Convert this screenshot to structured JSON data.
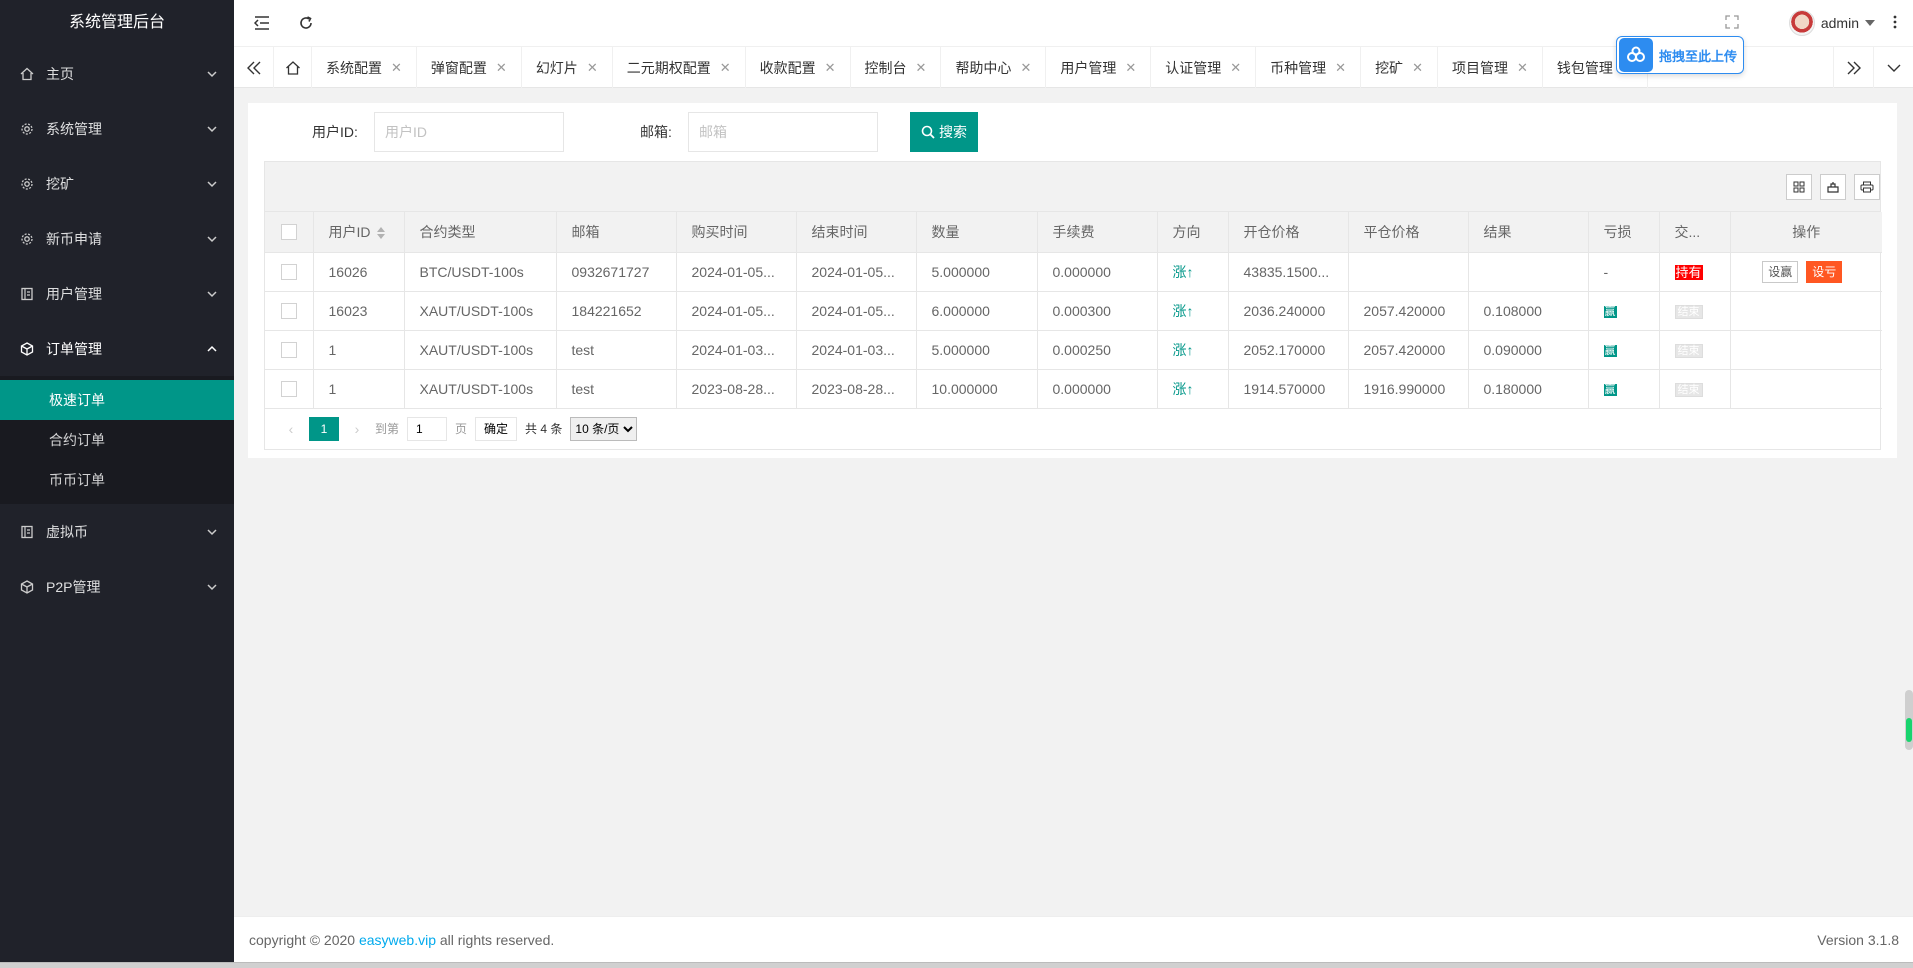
{
  "app": {
    "title": "系统管理后台"
  },
  "sidebar": {
    "items": [
      {
        "label": "主页",
        "icon": "home-icon"
      },
      {
        "label": "系统管理",
        "icon": "gear-icon"
      },
      {
        "label": "挖矿",
        "icon": "gear-icon"
      },
      {
        "label": "新币申请",
        "icon": "gear-icon"
      },
      {
        "label": "用户管理",
        "icon": "ledger-icon"
      },
      {
        "label": "订单管理",
        "icon": "cube-icon"
      },
      {
        "label": "虚拟币",
        "icon": "ledger-icon"
      },
      {
        "label": "P2P管理",
        "icon": "cube-icon"
      }
    ],
    "order_sub": [
      "极速订单",
      "合约订单",
      "币币订单"
    ]
  },
  "header": {
    "user": "admin"
  },
  "tabs": [
    "系统配置",
    "弹窗配置",
    "幻灯片",
    "二元期权配置",
    "收款配置",
    "控制台",
    "帮助中心",
    "用户管理",
    "认证管理",
    "币种管理",
    "挖矿",
    "项目管理",
    "钱包管理"
  ],
  "upload": {
    "label": "拖拽至此上传"
  },
  "search": {
    "uid_label": "用户ID:",
    "uid_placeholder": "用户ID",
    "email_label": "邮箱:",
    "email_placeholder": "邮箱",
    "button": "搜索"
  },
  "table": {
    "headers": [
      "用户ID",
      "合约类型",
      "邮箱",
      "购买时间",
      "结束时间",
      "数量",
      "手续费",
      "方向",
      "开仓价格",
      "平仓价格",
      "结果",
      "亏损",
      "交...",
      "操作"
    ],
    "rows": [
      {
        "uid": "16026",
        "type": "BTC/USDT-100s",
        "email": "0932671727",
        "buy": "2024-01-05...",
        "end": "2024-01-05...",
        "qty": "5.000000",
        "fee": "0.000000",
        "dir": "涨↑",
        "open": "43835.1500...",
        "close": "",
        "result": "",
        "loss": "-",
        "status": "持有",
        "ops": [
          "设赢",
          "设亏"
        ]
      },
      {
        "uid": "16023",
        "type": "XAUT/USDT-100s",
        "email": "184221652",
        "buy": "2024-01-05...",
        "end": "2024-01-05...",
        "qty": "6.000000",
        "fee": "0.000300",
        "dir": "涨↑",
        "open": "2036.240000",
        "close": "2057.420000",
        "result": "0.108000",
        "loss": "赢",
        "status": "结束"
      },
      {
        "uid": "1",
        "type": "XAUT/USDT-100s",
        "email": "test",
        "buy": "2024-01-03...",
        "end": "2024-01-03...",
        "qty": "5.000000",
        "fee": "0.000250",
        "dir": "涨↑",
        "open": "2052.170000",
        "close": "2057.420000",
        "result": "0.090000",
        "loss": "赢",
        "status": "结束"
      },
      {
        "uid": "1",
        "type": "XAUT/USDT-100s",
        "email": "test",
        "buy": "2023-08-28...",
        "end": "2023-08-28...",
        "qty": "10.000000",
        "fee": "0.000000",
        "dir": "涨↑",
        "open": "1914.570000",
        "close": "1916.990000",
        "result": "0.180000",
        "loss": "赢",
        "status": "结束"
      }
    ]
  },
  "pager": {
    "current": "1",
    "goto_label": "到第",
    "goto_value": "1",
    "page_unit": "页",
    "confirm": "确定",
    "total": "共 4 条",
    "size": "10 条/页"
  },
  "footer": {
    "copyright_prefix": "copyright © 2020 ",
    "link": "easyweb.vip",
    "copyright_suffix": " all rights reserved.",
    "version": "Version 3.1.8"
  },
  "colors": {
    "sidebar": "#20222a",
    "accent": "#009688",
    "danger": "#ff5722",
    "hold": "#ff0000"
  }
}
